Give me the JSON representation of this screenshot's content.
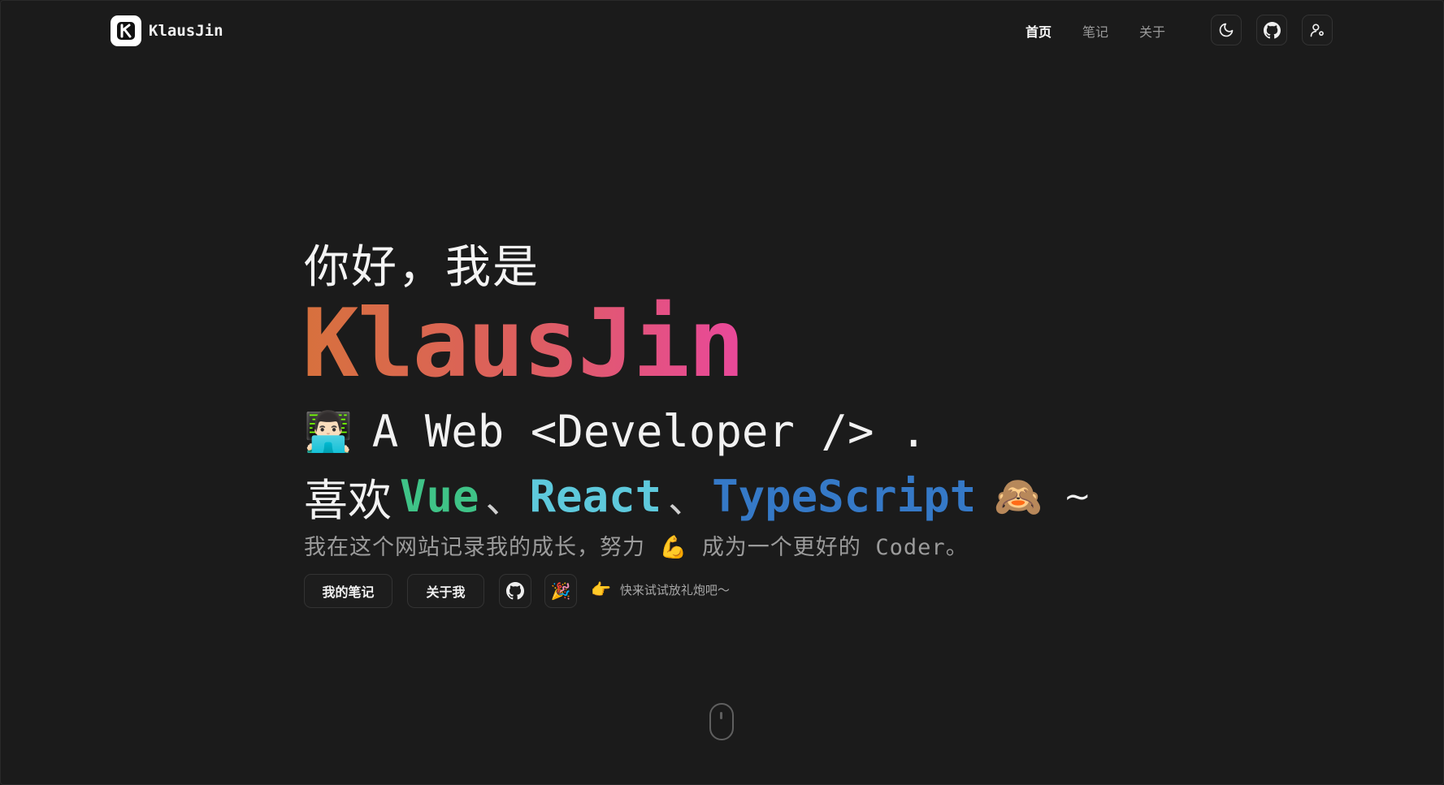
{
  "header": {
    "brand": "KlausJin",
    "nav": [
      {
        "label": "首页",
        "active": true
      },
      {
        "label": "笔记",
        "active": false
      },
      {
        "label": "关于",
        "active": false
      }
    ],
    "icons": [
      "moon-icon",
      "github-icon",
      "user-settings-icon"
    ]
  },
  "hero": {
    "greeting": "你好，我是",
    "name": "KlausJin",
    "role_emoji": "👨🏻‍💻",
    "role": "A Web <Developer /> .",
    "likes_prefix": "喜欢",
    "tech": [
      "Vue",
      "React",
      "TypeScript"
    ],
    "sep": "、",
    "likes_emoji": "🙈",
    "likes_suffix": "~",
    "desc_part1": "我在这个网站记录我的成长，努力",
    "desc_emoji": "💪",
    "desc_part2": "成为一个更好的",
    "desc_mono": "Coder",
    "desc_end": "。"
  },
  "actions": {
    "notes_button": "我的笔记",
    "about_button": "关于我",
    "party_emoji": "🎉",
    "hint_emoji": "👈",
    "hint_text": "快来试试放礼炮吧～"
  },
  "colors": {
    "background": "#1b1b1b",
    "vue": "#3fc387",
    "react": "#5ec9dc",
    "typescript": "#3579c7",
    "name_gradient": [
      "#d7713d",
      "#dd5f5f",
      "#e9489b"
    ]
  }
}
